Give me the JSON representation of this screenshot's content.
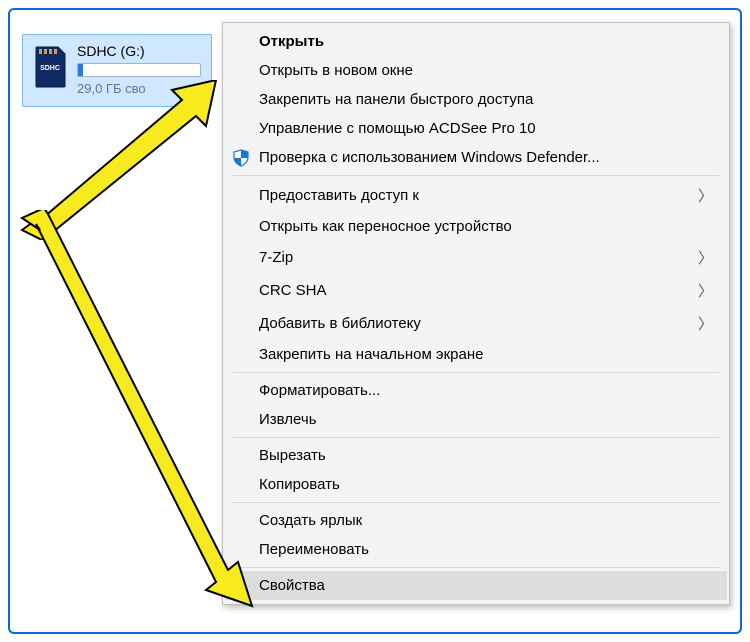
{
  "drive": {
    "title": "SDHC (G:)",
    "free_caption": "29,0 ГБ сво",
    "icon_text_top": "SDHC",
    "icon_text_bottom": ""
  },
  "context_menu": {
    "items": [
      {
        "label": "Открыть",
        "bold": true
      },
      {
        "label": "Открыть в новом окне"
      },
      {
        "label": "Закрепить на панели быстрого доступа"
      },
      {
        "label": "Управление с помощью ACDSee Pro 10"
      },
      {
        "label": "Проверка с использованием Windows Defender...",
        "icon": "defender"
      },
      {
        "sep": true
      },
      {
        "label": "Предоставить доступ к",
        "submenu": true
      },
      {
        "label": "Открыть как переносное устройство"
      },
      {
        "label": "7-Zip",
        "submenu": true
      },
      {
        "label": "CRC SHA",
        "submenu": true
      },
      {
        "label": "Добавить в библиотеку",
        "submenu": true
      },
      {
        "label": "Закрепить на начальном экране"
      },
      {
        "sep": true
      },
      {
        "label": "Форматировать..."
      },
      {
        "label": "Извлечь"
      },
      {
        "sep": true
      },
      {
        "label": "Вырезать"
      },
      {
        "label": "Копировать"
      },
      {
        "sep": true
      },
      {
        "label": "Создать ярлык"
      },
      {
        "label": "Переименовать"
      },
      {
        "sep": true
      },
      {
        "label": "Свойства",
        "highlighted": true
      }
    ]
  },
  "icons": {
    "submenu_glyph": "〉"
  }
}
